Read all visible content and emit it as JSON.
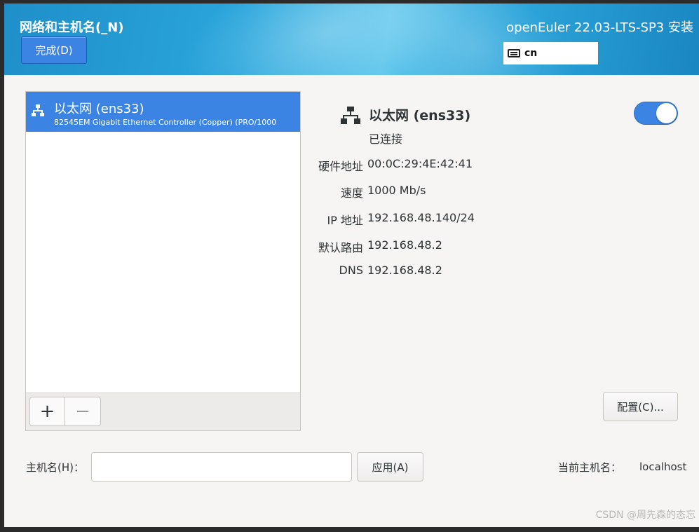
{
  "header": {
    "title": "网络和主机名(_N)",
    "done_label": "完成(D)",
    "product": "openEuler 22.03-LTS-SP3 安装",
    "keyboard_icon": "keyboard-icon",
    "keyboard_layout": "cn"
  },
  "devices": [
    {
      "icon": "network-wired-icon",
      "name": "以太网 (ens33)",
      "description": "82545EM Gigabit Ethernet Controller (Copper) (PRO/1000"
    }
  ],
  "toolbar": {
    "add_label": "+",
    "remove_label": "−"
  },
  "details": {
    "icon": "network-wired-icon",
    "title": "以太网 (ens33)",
    "status": "已连接",
    "enabled": true,
    "properties": [
      {
        "label": "硬件地址",
        "value": "00:0C:29:4E:42:41"
      },
      {
        "label": "速度",
        "value": "1000 Mb/s"
      },
      {
        "label": "IP 地址",
        "value": "192.168.48.140/24"
      },
      {
        "label": "默认路由",
        "value": "192.168.48.2"
      },
      {
        "label": "DNS",
        "value": "192.168.48.2"
      }
    ],
    "config_label": "配置(C)..."
  },
  "hostname": {
    "label": "主机名(H)：",
    "value": "",
    "apply_label": "应用(A)",
    "current_label": "当前主机名：",
    "current_value": "localhost"
  },
  "watermark": "CSDN @周先森的态忘",
  "colors": {
    "accent": "#3b84e3",
    "header": "#2aa6dc",
    "background": "#f6f5f4"
  }
}
